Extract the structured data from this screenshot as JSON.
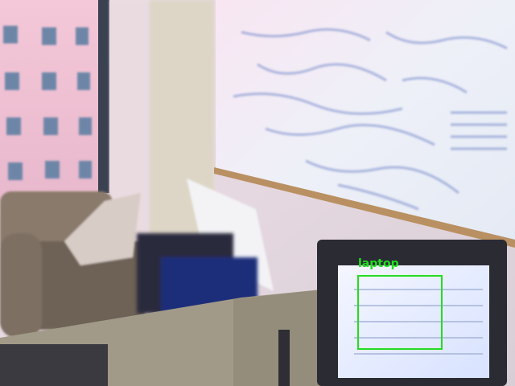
{
  "scene": {
    "description_free": true
  },
  "detections": [
    {
      "label": "laptop",
      "color": "#22dd22"
    }
  ],
  "colors": {
    "box": "#22dd22"
  }
}
